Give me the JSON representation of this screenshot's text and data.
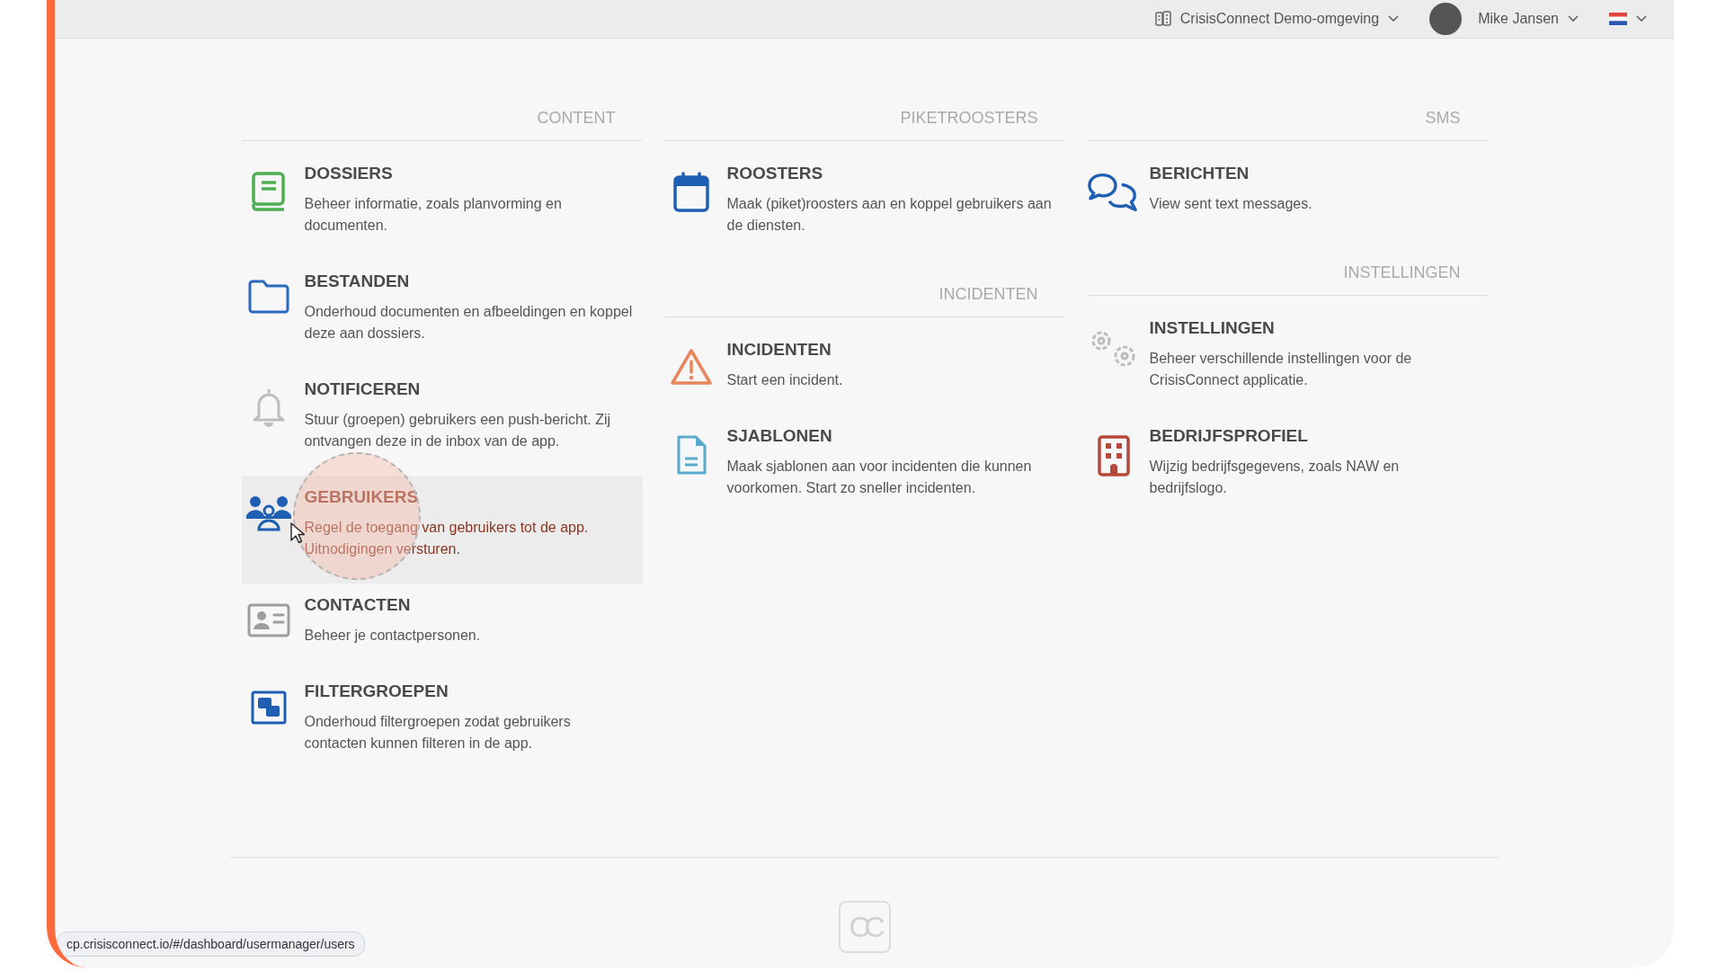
{
  "top_bar": {
    "organization": "CrisisConnect Demo-omgeving",
    "user_name": "Mike Jansen"
  },
  "columns": [
    {
      "sections": [
        {
          "title": "CONTENT",
          "items": [
            {
              "title": "DOSSIERS",
              "description": "Beheer informatie, zoals planvorming en documenten.",
              "hovered": false
            },
            {
              "title": "BESTANDEN",
              "description": "Onderhoud documenten en afbeeldingen en koppel deze aan dossiers.",
              "hovered": false
            },
            {
              "title": "NOTIFICEREN",
              "description": "Stuur (groepen) gebruikers een push-bericht. Zij ontvangen deze in de inbox van de app.",
              "hovered": false
            },
            {
              "title": "GEBRUIKERS",
              "description": "Regel de toegang van gebruikers tot de app. Uitnodigingen versturen.",
              "hovered": true
            },
            {
              "title": "CONTACTEN",
              "description": "Beheer je contactpersonen.",
              "hovered": false
            },
            {
              "title": "FILTERGROEPEN",
              "description": "Onderhoud filtergroepen zodat gebruikers contacten kunnen filteren in de app.",
              "hovered": false
            }
          ]
        }
      ]
    },
    {
      "sections": [
        {
          "title": "PIKETROOSTERS",
          "items": [
            {
              "title": "ROOSTERS",
              "description": "Maak (piket)roosters aan en koppel gebruikers aan de diensten.",
              "hovered": false
            }
          ]
        },
        {
          "title": "INCIDENTEN",
          "items": [
            {
              "title": "INCIDENTEN",
              "description": "Start een incident.",
              "hovered": false
            },
            {
              "title": "SJABLONEN",
              "description": "Maak sjablonen aan voor incidenten die kunnen voorkomen. Start zo sneller incidenten.",
              "hovered": false
            }
          ]
        }
      ]
    },
    {
      "sections": [
        {
          "title": "SMS",
          "items": [
            {
              "title": "BERICHTEN",
              "description": "View sent text messages.",
              "hovered": false
            }
          ]
        },
        {
          "title": "INSTELLINGEN",
          "items": [
            {
              "title": "INSTELLINGEN",
              "description": "Beheer verschillende instellingen voor de CrisisConnect applicatie.",
              "hovered": false
            },
            {
              "title": "BEDRIJFSPROFIEL",
              "description": "Wijzig bedrijfsgegevens, zoals NAW en bedrijfslogo.",
              "hovered": false
            }
          ]
        }
      ]
    }
  ],
  "footer": {
    "logo": "CC"
  },
  "status_url": "cp.crisisconnect.io/#/dashboard/usermanager/users"
}
